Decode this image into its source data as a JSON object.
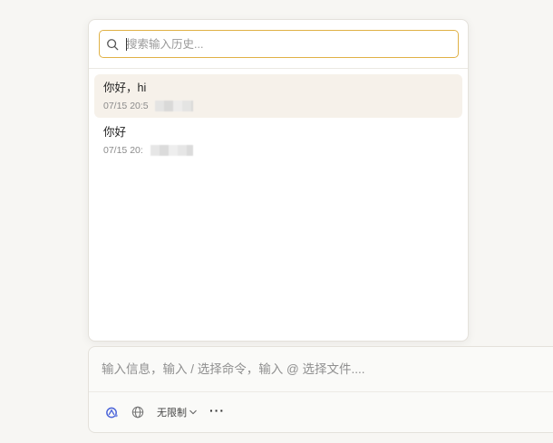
{
  "history": {
    "search": {
      "placeholder": "搜索输入历史...",
      "value": ""
    },
    "items": [
      {
        "title": "你好，hi",
        "time": "07/15 20:5",
        "active": true
      },
      {
        "title": "你好",
        "time": "07/15 20:",
        "active": false
      }
    ]
  },
  "composer": {
    "placeholder": "输入信息，输入 / 选择命令，输入 @ 选择文件....",
    "toolbar": {
      "limit_label": "无限制",
      "more_label": "···"
    }
  },
  "colors": {
    "accent_focus": "#e0b146",
    "active_item_bg": "#f6f1ea",
    "ai_icon": "#4a63d8"
  },
  "icons": [
    "search-icon",
    "ai-assistant-icon",
    "globe-icon",
    "chevron-down-icon",
    "more-icon"
  ]
}
